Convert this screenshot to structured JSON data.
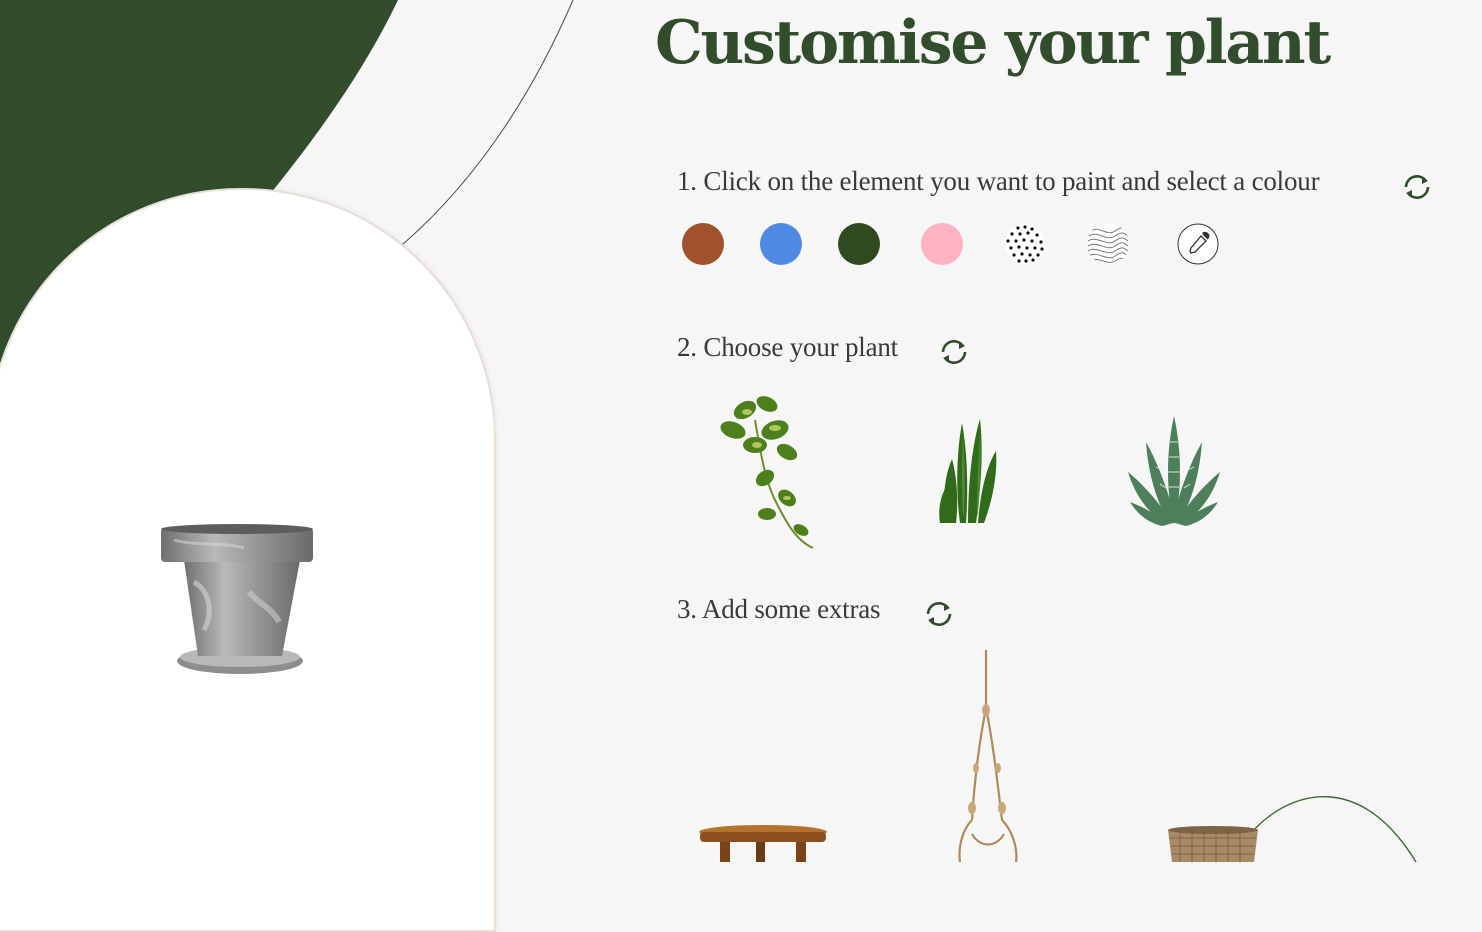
{
  "page": {
    "title": "Customise your plant"
  },
  "steps": {
    "colour": {
      "label": "1. Click on the element you want to paint and select a colour",
      "reset_icon": "refresh-icon"
    },
    "plant": {
      "label": "2. Choose your plant",
      "reset_icon": "refresh-icon"
    },
    "extras": {
      "label": "3. Add some extras",
      "reset_icon": "refresh-icon"
    }
  },
  "swatches": [
    {
      "name": "terracotta",
      "color": "#a0522d"
    },
    {
      "name": "blue",
      "color": "#4f8be6"
    },
    {
      "name": "dark-green",
      "color": "#2f4a1e"
    },
    {
      "name": "pink",
      "color": "#ffb3c1"
    },
    {
      "name": "dots-pattern",
      "icon": "dots-pattern-icon"
    },
    {
      "name": "waves-pattern",
      "icon": "waves-pattern-icon"
    },
    {
      "name": "custom-colour",
      "icon": "eyedropper-icon"
    }
  ],
  "plants": [
    {
      "name": "pothos",
      "icon": "pothos-plant-icon"
    },
    {
      "name": "cactus",
      "icon": "cactus-plant-icon"
    },
    {
      "name": "aloe",
      "icon": "aloe-plant-icon"
    }
  ],
  "extras": [
    {
      "name": "wooden-stool",
      "icon": "stool-icon"
    },
    {
      "name": "macrame-hanger",
      "icon": "macrame-hanger-icon"
    },
    {
      "name": "woven-basket",
      "icon": "basket-icon"
    }
  ],
  "colors": {
    "brand_green": "#314d2c",
    "background": "#f6f6f7"
  }
}
